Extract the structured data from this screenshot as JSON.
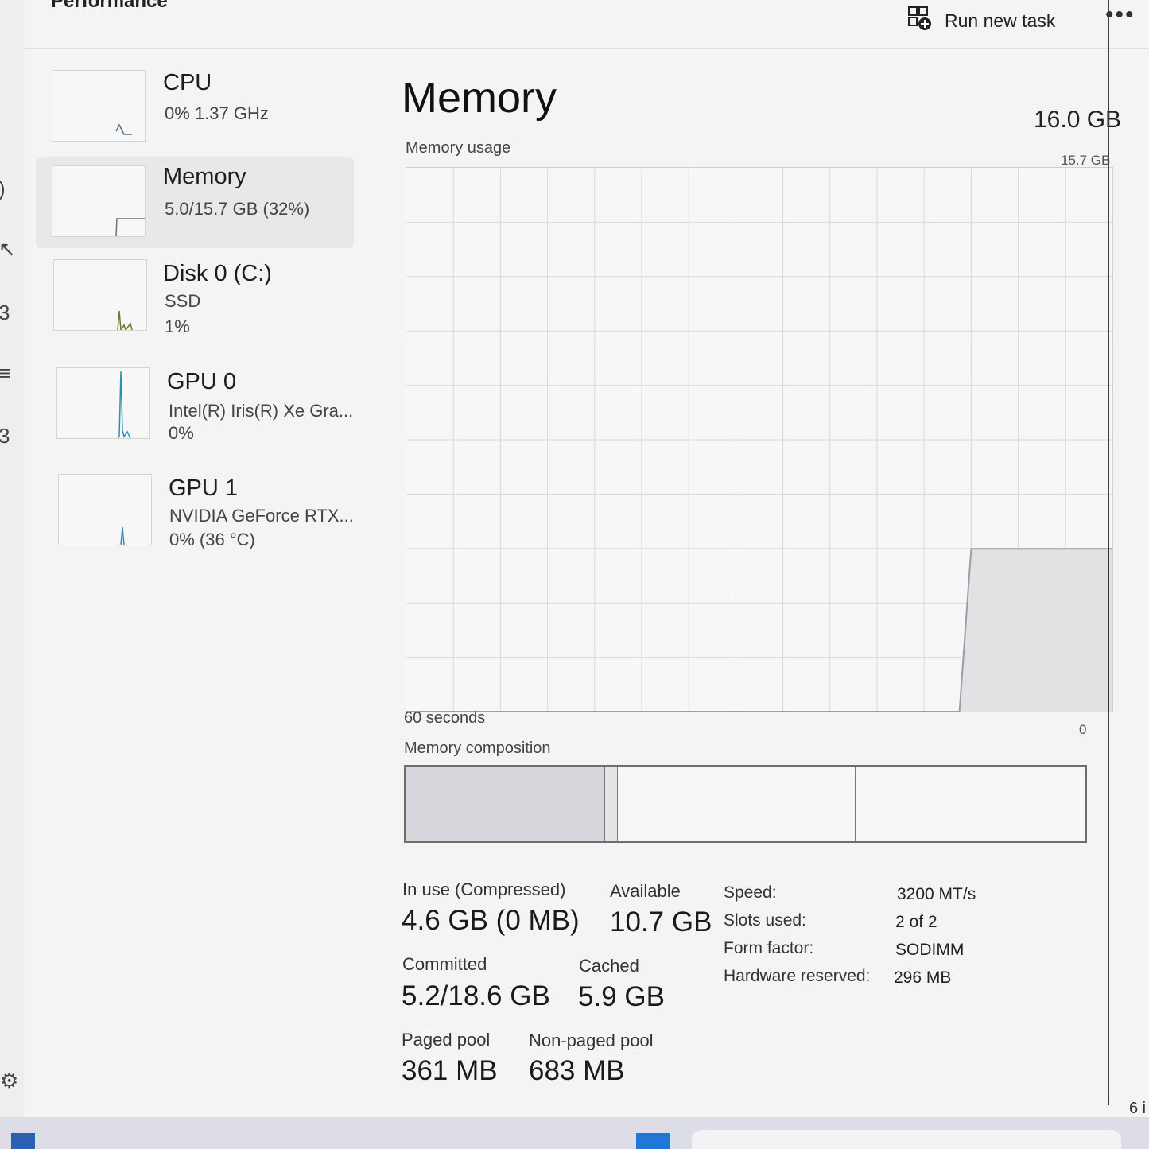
{
  "header": {
    "title": "Performance",
    "run_new_task": "Run new task",
    "more_label": "•••"
  },
  "sidebar": {
    "items": [
      {
        "title": "CPU",
        "line1": "0%  1.37 GHz",
        "line2": ""
      },
      {
        "title": "Memory",
        "line1": "5.0/15.7 GB (32%)",
        "line2": ""
      },
      {
        "title": "Disk 0 (C:)",
        "line1": "SSD",
        "line2": "1%"
      },
      {
        "title": "GPU 0",
        "line1": "Intel(R) Iris(R) Xe Gra...",
        "line2": "0%"
      },
      {
        "title": "GPU 1",
        "line1": "NVIDIA GeForce RTX...",
        "line2": "0%  (36 °C)"
      }
    ]
  },
  "main": {
    "title": "Memory",
    "total": "16.0 GB",
    "usage_label": "Memory usage",
    "usage_max": "15.7 GB",
    "time_left": "60 seconds",
    "time_right": "0",
    "composition_label": "Memory composition"
  },
  "usage_graph": {
    "max_gb": 15.7,
    "window_seconds": 60,
    "points": [
      [
        60,
        0
      ],
      [
        13,
        0
      ],
      [
        12,
        4.7
      ],
      [
        0,
        4.7
      ]
    ]
  },
  "composition": {
    "segments_gb": [
      {
        "name": "In use",
        "value": 4.6,
        "color": "#d6d6dc"
      },
      {
        "name": "Modified",
        "value": 0.3,
        "color": "#e4e4e6"
      },
      {
        "name": "Standby",
        "value": 5.5,
        "color": "#f7f7f7"
      },
      {
        "name": "Free",
        "value": 5.3,
        "color": "#f7f7f7"
      }
    ]
  },
  "stats": {
    "in_use_label": "In use (Compressed)",
    "in_use_value": "4.6 GB (0 MB)",
    "available_label": "Available",
    "available_value": "10.7 GB",
    "committed_label": "Committed",
    "committed_value": "5.2/18.6 GB",
    "cached_label": "Cached",
    "cached_value": "5.9 GB",
    "paged_label": "Paged pool",
    "paged_value": "361 MB",
    "nonpaged_label": "Non-paged pool",
    "nonpaged_value": "683 MB"
  },
  "specs": {
    "speed_label": "Speed:",
    "speed_value": "3200 MT/s",
    "slots_label": "Slots used:",
    "slots_value": "2 of 2",
    "form_label": "Form factor:",
    "form_value": "SODIMM",
    "reserved_label": "Hardware reserved:",
    "reserved_value": "296 MB"
  },
  "footer": {
    "corner_text": "6 i"
  },
  "icons": [
    "run-task-icon",
    "more-icon",
    "settings-icon",
    "start-icon"
  ],
  "colors": {
    "graph_line": "#a19aa8",
    "graph_fill": "#e2e2e4",
    "grid": "#d9d9d9",
    "gpu_spike": "#2f8fb9",
    "disk_spike": "#6f7a2a"
  }
}
